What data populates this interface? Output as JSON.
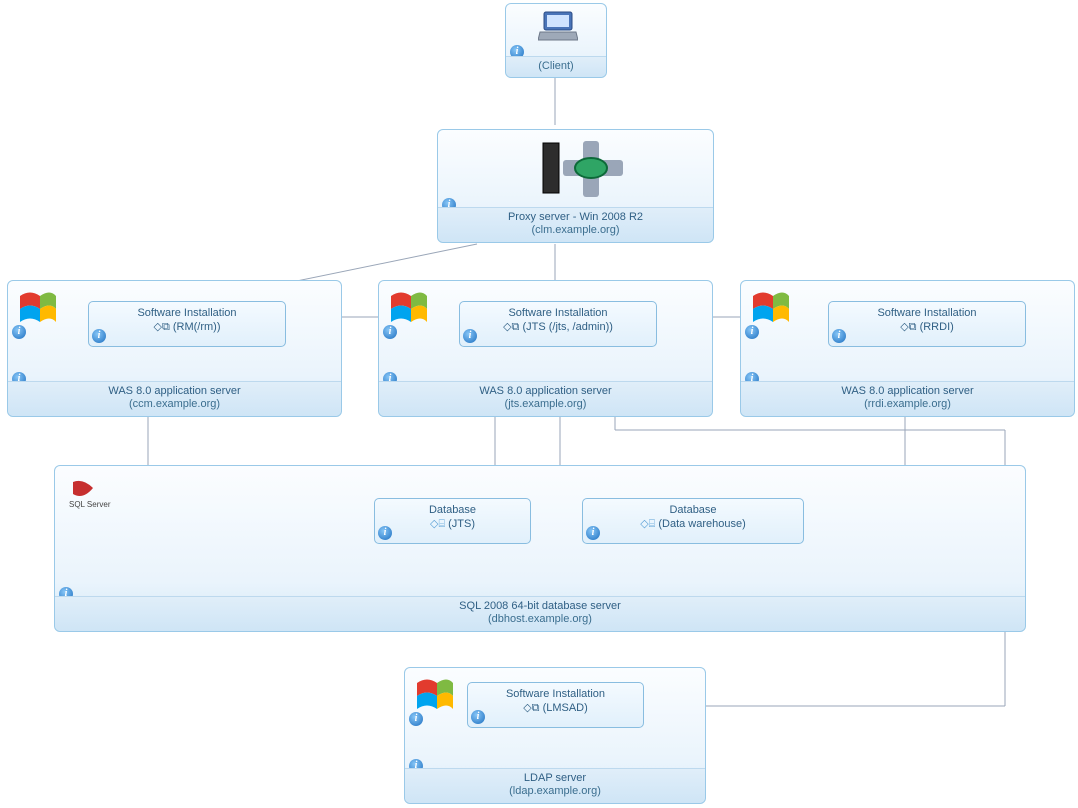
{
  "client": {
    "label": "(Client)"
  },
  "proxy": {
    "title": "Proxy server - Win 2008 R2",
    "host": "(clm.example.org)"
  },
  "was": {
    "rm": {
      "si": "Software Installation",
      "app": "(RM(/rm))",
      "title": "WAS 8.0 application server",
      "host": "(ccm.example.org)"
    },
    "jts": {
      "si": "Software Installation",
      "app": "(JTS (/jts, /admin))",
      "title": "WAS 8.0 application server",
      "host": "(jts.example.org)"
    },
    "rrdi": {
      "si": "Software Installation",
      "app": "(RRDI)",
      "title": "WAS 8.0 application server",
      "host": "(rrdi.example.org)"
    }
  },
  "sql": {
    "db_jts": {
      "hdr": "Database",
      "val": "(JTS)"
    },
    "db_dw": {
      "hdr": "Database",
      "val": "(Data warehouse)"
    },
    "title": "SQL 2008 64-bit database server",
    "host": "(dbhost.example.org)",
    "logo": "SQL Server"
  },
  "ldap": {
    "si": "Software Installation",
    "app": "(LMSAD)",
    "title": "LDAP server",
    "host": "(ldap.example.org)"
  }
}
